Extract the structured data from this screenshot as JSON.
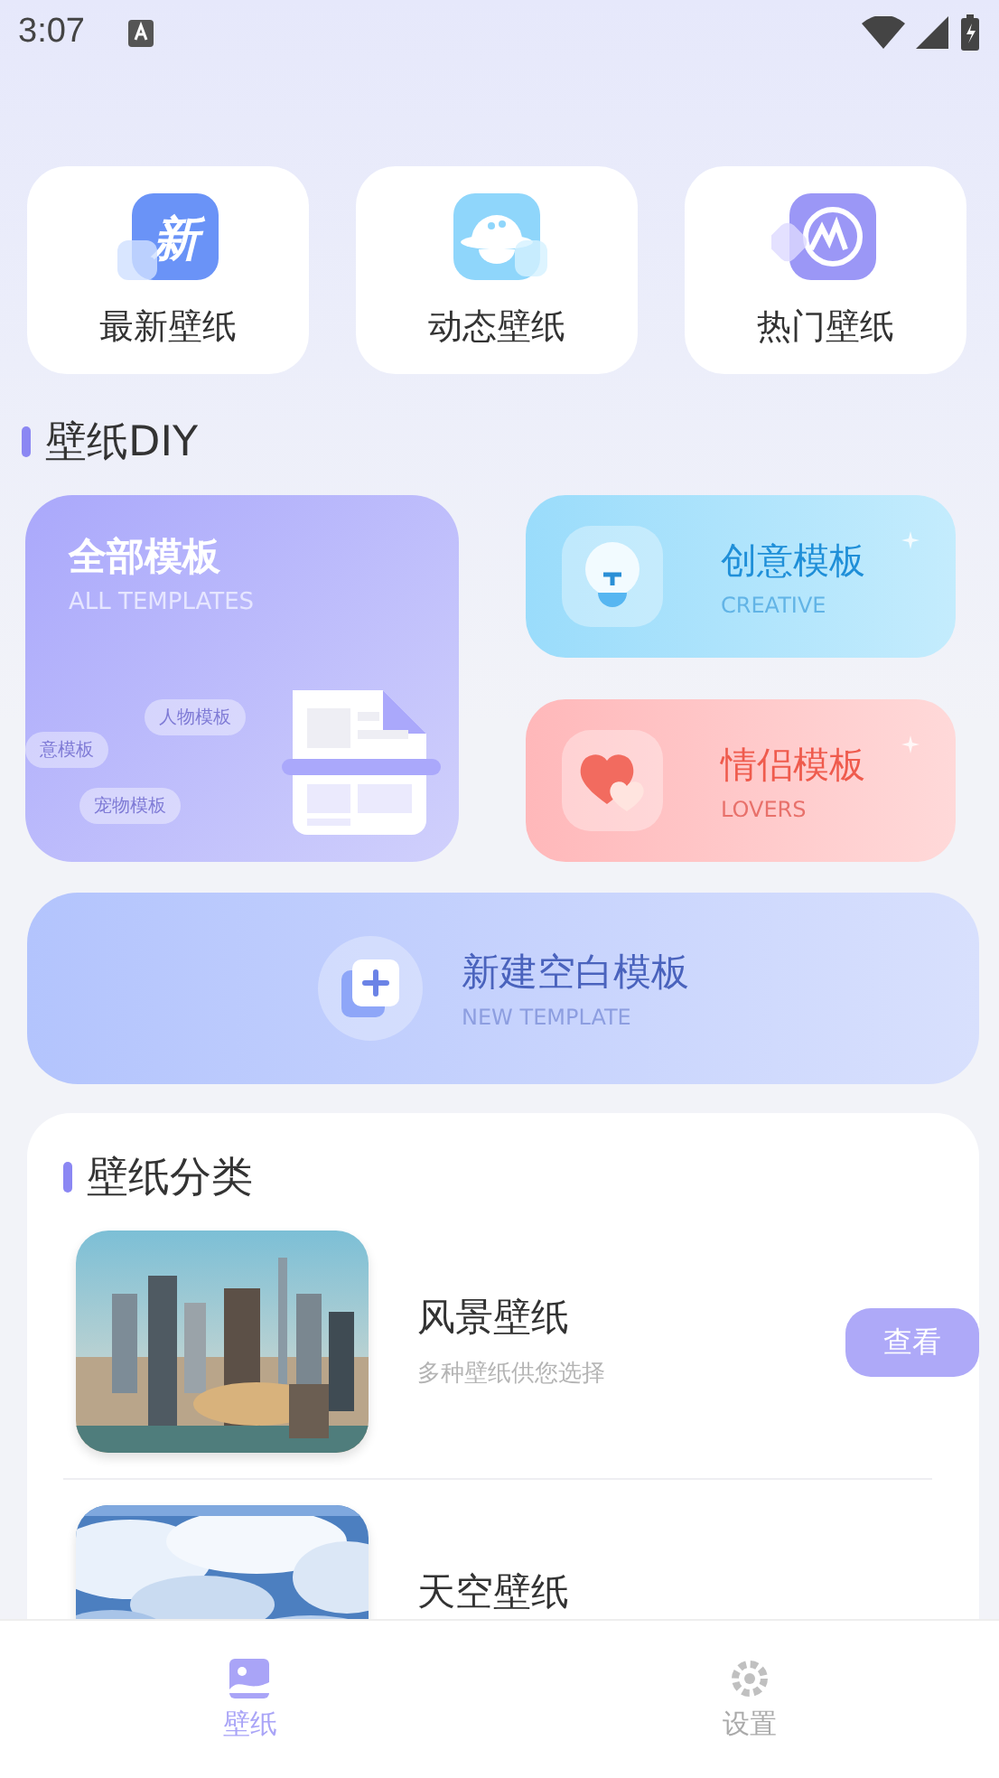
{
  "status_bar": {
    "time": "3:07"
  },
  "shortcuts": [
    {
      "label": "最新壁纸",
      "kind": "new",
      "icon_text": "新"
    },
    {
      "label": "动态壁纸",
      "kind": "live"
    },
    {
      "label": "热门壁纸",
      "kind": "hot"
    }
  ],
  "diy": {
    "title": "壁纸DIY",
    "all_templates": {
      "title": "全部模板",
      "subtitle": "ALL TEMPLATES",
      "chips": [
        "人物模板",
        "意模板",
        "宠物模板"
      ]
    },
    "cards": [
      {
        "kind": "creative",
        "title": "创意模板",
        "subtitle": "CREATIVE"
      },
      {
        "kind": "lovers",
        "title": "情侣模板",
        "subtitle": "LOVERS"
      }
    ],
    "new_template": {
      "title": "新建空白模板",
      "subtitle": "NEW TEMPLATE"
    }
  },
  "categories": {
    "title": "壁纸分类",
    "items": [
      {
        "kind": "city",
        "title": "风景壁纸",
        "subtitle": "多种壁纸供您选择",
        "button": "查看"
      },
      {
        "kind": "sky",
        "title": "天空壁纸"
      }
    ]
  },
  "bottom_nav": [
    {
      "label": "壁纸",
      "kind": "wallpaper",
      "selected": true
    },
    {
      "label": "设置",
      "kind": "settings",
      "selected": false
    }
  ]
}
